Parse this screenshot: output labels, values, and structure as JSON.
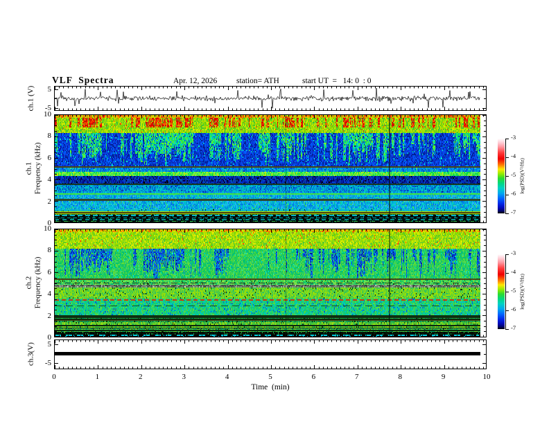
{
  "header": {
    "title": "VLF  Spectra",
    "date": "Apr. 12, 2026",
    "station": "station= ATH",
    "start_ut": "start UT  =   14: 0  : 0"
  },
  "x_axis": {
    "label": "Time  (min)",
    "ticks": [
      "0",
      "1",
      "2",
      "3",
      "4",
      "5",
      "6",
      "7",
      "8",
      "9",
      "10"
    ]
  },
  "left_labels": {
    "ch1_wave": "ch.1 (V)",
    "ch1_spec_line1": "ch.1",
    "ch1_spec_line2": "Frequency  (kHz)",
    "ch2_spec_line1": "ch.2",
    "ch2_spec_line2": "Frequency  (kHz)",
    "ch3_wave": "ch.3(V)"
  },
  "y_ticks": {
    "wave1": [
      "5",
      "-5"
    ],
    "spec": [
      "10",
      "8",
      "6",
      "4",
      "2",
      "0"
    ],
    "wave3": [
      "5",
      "-5"
    ]
  },
  "colorbar": {
    "label": "log(PSD)(V²/Hz)",
    "ticks": [
      "-3",
      "-4",
      "-5",
      "-6",
      "-7"
    ],
    "gradient": [
      {
        "c": "#ffffff",
        "p": 0
      },
      {
        "c": "#ffd2da",
        "p": 5
      },
      {
        "c": "#ff99a2",
        "p": 11
      },
      {
        "c": "#ff3a3a",
        "p": 19
      },
      {
        "c": "#f00000",
        "p": 27
      },
      {
        "c": "#ff7800",
        "p": 35
      },
      {
        "c": "#ffe800",
        "p": 41
      },
      {
        "c": "#96ec00",
        "p": 47
      },
      {
        "c": "#2edc2e",
        "p": 53
      },
      {
        "c": "#00d884",
        "p": 60
      },
      {
        "c": "#00d2c2",
        "p": 66
      },
      {
        "c": "#00aaee",
        "p": 73
      },
      {
        "c": "#0066ff",
        "p": 80
      },
      {
        "c": "#0028e8",
        "p": 87
      },
      {
        "c": "#0008b4",
        "p": 93
      },
      {
        "c": "#000464",
        "p": 97
      },
      {
        "c": "#000000",
        "p": 100
      }
    ]
  },
  "chart_data": {
    "type": "heatmap",
    "title": "VLF Spectra",
    "x": {
      "label": "Time (min)",
      "range": [
        0,
        10
      ],
      "ticks": [
        0,
        1,
        2,
        3,
        4,
        5,
        6,
        7,
        8,
        9,
        10
      ],
      "data_end_min": 9.84
    },
    "colorbar": {
      "label": "log(PSD)(V^2/Hz)",
      "ticks": [
        -3,
        -4,
        -5,
        -6,
        -7
      ],
      "top_value": -3,
      "bottom_value": -7
    },
    "panels": [
      {
        "id": "ch1_waveform",
        "type": "line",
        "ylabel": "ch.1 (V)",
        "yticks": [
          5,
          -5
        ],
        "yrange": [
          -6.6,
          6.6
        ],
        "description": "broadband noise around 0 V with impulsive spikes reaching about +/-5 V",
        "seed": 20260412,
        "noise_amp_v": 0.8,
        "spike_prob": 0.05,
        "spike_v": [
          2.5,
          5.2
        ]
      },
      {
        "id": "ch1_spectrogram",
        "type": "spectrogram",
        "ylabels": [
          "ch.1",
          "Frequency (kHz)"
        ],
        "yticks": [
          10,
          8,
          6,
          4,
          2,
          0
        ],
        "freq_range_khz": [
          0,
          10
        ],
        "seed": 1101,
        "bands": [
          {
            "f": [
              9.78,
              10.01
            ],
            "bg": [
              "#ff5a00",
              "#e0d800",
              "#ff2e00",
              "#96dc00",
              "#ffa000",
              "#c8e400"
            ]
          },
          {
            "f": [
              8.35,
              9.78
            ],
            "bg": [
              "#8cd800",
              "#b4e400",
              "#5ecc10",
              "#d8ec00",
              "#3cc43c",
              "#a6e000"
            ],
            "streak": [
              "#e80000",
              "#ff6000",
              "#c81400"
            ],
            "streak_threshold": 0.86,
            "streak_fmin": 8.9,
            "speck": [
              "#ff3c00",
              "#ff9600"
            ],
            "speck_prob": 0.045
          },
          {
            "f": [
              5.35,
              8.35
            ],
            "bg": [
              "#0834d8",
              "#0050f0",
              "#0820a8",
              "#0060ff",
              "#1040e0",
              "#002090"
            ],
            "streak": [
              "#00e070",
              "#38e838",
              "#00c8a8",
              "#70f030",
              "#00d2d2"
            ],
            "streak_threshold": 0.52,
            "speck": [
              "#00e8c8"
            ],
            "speck_prob": 0.045
          },
          {
            "f": [
              4.78,
              5.35
            ],
            "bg": [
              "#0068e8",
              "#00a0d8",
              "#0048c8",
              "#00c0c8",
              "#0080f0"
            ],
            "speck": [
              "#40e870"
            ],
            "speck_prob": 0.05
          },
          {
            "f": [
              4.38,
              4.78
            ],
            "bg": [
              "#2ce42c",
              "#58f058",
              "#9cec28",
              "#00d854",
              "#44e874"
            ],
            "speck": [
              "#c8e800"
            ],
            "speck_prob": 0.08
          },
          {
            "f": [
              3.56,
              4.38
            ],
            "bg": [
              "#0028c0",
              "#061090",
              "#0040e0",
              "#000668",
              "#0858a0",
              "#0030b4"
            ],
            "speck": [
              "#000000"
            ],
            "speck_prob": 0.07
          },
          {
            "f": [
              2.86,
              3.56
            ],
            "bg": [
              "#00a8e0",
              "#0078e0",
              "#00c8c8",
              "#0058d8",
              "#00b8b4"
            ],
            "speck": [
              "#0030a0"
            ],
            "speck_prob": 0.05
          },
          {
            "f": [
              1.35,
              2.86
            ],
            "bg": [
              "#00b4e0",
              "#0090e0",
              "#00ccc0",
              "#2cb4ff",
              "#0074e4",
              "#00c8cc"
            ],
            "speck": [
              "#40e060"
            ],
            "speck_prob": 0.06
          },
          {
            "f": [
              1.05,
              1.35
            ],
            "bg": [
              "#00c0c8",
              "#00a8d8",
              "#20c8a8"
            ],
            "speck": [
              "#0c300c"
            ],
            "speck_prob": 0.06
          },
          {
            "f": [
              0.78,
              1.05
            ],
            "bg": [
              "#1c481c",
              "#0c300c",
              "#009478",
              "#506010"
            ],
            "speck": [
              "#a0cc00"
            ],
            "speck_prob": 0.1
          },
          {
            "f": [
              0,
              0.78
            ],
            "bg": [
              "#000000",
              "#041004",
              "#020a14"
            ],
            "speck": [
              "#00a058",
              "#008888"
            ],
            "speck_prob": 0.06
          }
        ],
        "hlines": [
          {
            "f": 5.16,
            "color": "#4a4414",
            "th": 2
          },
          {
            "f": 3.52,
            "color": "#143820",
            "th": 2
          },
          {
            "f": 2.62,
            "color": "#40e040",
            "th": 2
          },
          {
            "f": 2.07,
            "color": "#2c482c",
            "th": 3
          },
          {
            "f": 1.02,
            "color": "#b4d800",
            "th": 1
          },
          {
            "f": 0.92,
            "color": "#4a4414",
            "th": 2
          },
          {
            "f": 0.83,
            "color": "#a0cc00",
            "th": 1
          },
          {
            "f": 0.62,
            "color": "#00b4c4",
            "th": 2,
            "dash": [
              7,
              4
            ]
          },
          {
            "f": 0.45,
            "color": "#00a0a0",
            "th": 1,
            "dash": [
              5,
              4
            ]
          },
          {
            "f": 0.28,
            "color": "#009090",
            "th": 2,
            "dash": [
              6,
              5
            ]
          },
          {
            "f": 0.12,
            "color": "#30b040",
            "th": 1,
            "dash": [
              8,
              5
            ]
          }
        ],
        "vlines": [
          {
            "t": 5.33,
            "color": "rgba(0,30,20,0.40)",
            "w": 1
          },
          {
            "t": 7.72,
            "color": "rgba(0,20,10,0.55)",
            "w": 2
          }
        ]
      },
      {
        "id": "ch2_spectrogram",
        "type": "spectrogram",
        "ylabels": [
          "ch.2",
          "Frequency (kHz)"
        ],
        "yticks": [
          10,
          8,
          6,
          4,
          2,
          0
        ],
        "freq_range_khz": [
          0,
          10
        ],
        "seed": 2202,
        "bands": [
          {
            "f": [
              9.8,
              10.01
            ],
            "bg": [
              "#c8e400",
              "#ff8000",
              "#a8e000",
              "#ff5000",
              "#e0ec00",
              "#8cd800"
            ]
          },
          {
            "f": [
              8.3,
              9.8
            ],
            "bg": [
              "#a8e000",
              "#c4e800",
              "#78d400",
              "#e0ec00",
              "#50c838",
              "#90dc10"
            ],
            "speck": [
              "#ff4600"
            ],
            "speck_prob": 0.02
          },
          {
            "f": [
              5.38,
              8.3
            ],
            "bg": [
              "#38d048",
              "#00c868",
              "#64dc38",
              "#00b88c",
              "#20cc58",
              "#48d860"
            ],
            "streak": [
              "#0838d8",
              "#0050f0",
              "#081c9c",
              "#0868e8",
              "#00a0d0"
            ],
            "streak_threshold": 0.6,
            "speck": [
              "#00e8d0"
            ],
            "speck_prob": 0.03
          },
          {
            "f": [
              4.92,
              5.38
            ],
            "bg": [
              "#38d048",
              "#58e058",
              "#00c474",
              "#80e040"
            ],
            "speck": [
              "#104010"
            ],
            "speck_prob": 0.05
          },
          {
            "f": [
              4.62,
              4.92
            ],
            "bg": [
              "#7c907c",
              "#5c705c",
              "#98a898",
              "#44544a",
              "#6a806a"
            ],
            "speck": [
              "#c0d0c0"
            ],
            "speck_prob": 0.06
          },
          {
            "f": [
              3.56,
              4.62
            ],
            "bg": [
              "#70d828",
              "#a0e000",
              "#44cc44",
              "#8cdc10",
              "#30c060"
            ],
            "speck": [
              "#0c300c"
            ],
            "speck_prob": 0.04
          },
          {
            "f": [
              2.06,
              3.56
            ],
            "bg": [
              "#28cc58",
              "#00d094",
              "#00c4c4",
              "#54dc44",
              "#10c87c"
            ],
            "speck": [
              "#0058d8"
            ],
            "speck_prob": 0.055
          },
          {
            "f": [
              1.48,
              2.06
            ],
            "bg": [
              "#20a838",
              "#009464",
              "#38b848",
              "#187c3c"
            ],
            "speck": [
              "#083008"
            ],
            "speck_prob": 0.1
          },
          {
            "f": [
              0.95,
              1.48
            ],
            "bg": [
              "#58cc28",
              "#98dc18",
              "#28b850"
            ],
            "speck": [
              "#144014"
            ],
            "speck_prob": 0.06
          },
          {
            "f": [
              0.52,
              0.95
            ],
            "bg": [
              "#38c048",
              "#74d030",
              "#00a468"
            ],
            "speck": [
              "#0c280c"
            ],
            "speck_prob": 0.08
          },
          {
            "f": [
              0.27,
              0.52
            ],
            "bg": [
              "#000000",
              "#041004",
              "#0a1c0a"
            ],
            "speck": [
              "#20a040"
            ],
            "speck_prob": 0.06
          },
          {
            "f": [
              0,
              0.27
            ],
            "bg": [
              "#020802",
              "#000000"
            ],
            "speck": [
              "#00c8d8"
            ],
            "speck_prob": 0.08
          }
        ],
        "hlines": [
          {
            "f": 5.35,
            "color": "#4a4414",
            "th": 2
          },
          {
            "f": 4.98,
            "color": "#2c3c2c",
            "th": 1,
            "dash": [
              9,
              5
            ]
          },
          {
            "f": 4.75,
            "color": "#303c30",
            "th": 1,
            "dash": [
              6,
              6
            ]
          },
          {
            "f": 3.45,
            "color": "#e03000",
            "th": 2,
            "dash": [
              6,
              4
            ]
          },
          {
            "f": 3.36,
            "color": "#c04800",
            "th": 1,
            "dash": [
              4,
              6
            ]
          },
          {
            "f": 2.9,
            "color": "#155020",
            "th": 1,
            "dash": [
              10,
              6
            ]
          },
          {
            "f": 1.95,
            "color": "#0c2c0c",
            "th": 2
          },
          {
            "f": 1.78,
            "color": "#123012",
            "th": 2
          },
          {
            "f": 1.6,
            "color": "#0c2c0c",
            "th": 2
          },
          {
            "f": 1.5,
            "color": "#4a4414",
            "th": 1
          },
          {
            "f": 1.06,
            "color": "#0c280c",
            "th": 2
          },
          {
            "f": 0.8,
            "color": "#123012",
            "th": 1
          },
          {
            "f": 0.6,
            "color": "#0c280c",
            "th": 2
          },
          {
            "f": 0.14,
            "color": "#00c8d8",
            "th": 2,
            "dash": [
              9,
              7
            ]
          }
        ],
        "vlines": [
          {
            "t": 5.33,
            "color": "rgba(0,25,15,0.35)",
            "w": 1
          },
          {
            "t": 7.72,
            "color": "rgba(0,20,10,0.50)",
            "w": 2
          }
        ]
      },
      {
        "id": "ch3_waveform",
        "type": "flatline",
        "ylabel": "ch.3(V)",
        "yticks": [
          5,
          -5
        ],
        "value_v": 0,
        "line_halfwidth_v": 0.9,
        "description": "constant 0 V thick black trace (dead channel)"
      }
    ]
  }
}
